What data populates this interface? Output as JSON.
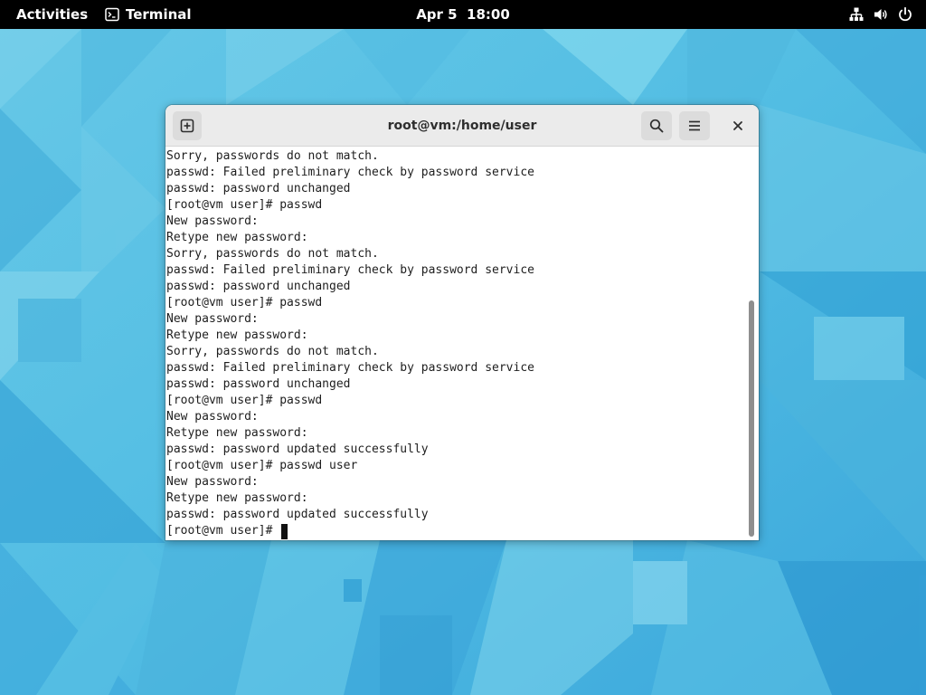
{
  "topbar": {
    "activities_label": "Activities",
    "app_name": "Terminal",
    "clock": "Apr 5  18:00",
    "tray_icons": [
      "network-wired-icon",
      "volume-icon",
      "power-icon"
    ]
  },
  "window": {
    "title": "root@vm:/home/user",
    "icons": [
      "new-tab-icon",
      "search-icon",
      "hamburger-menu-icon",
      "close-icon"
    ]
  },
  "terminal": {
    "lines": [
      "Sorry, passwords do not match.",
      "passwd: Failed preliminary check by password service",
      "passwd: password unchanged",
      "[root@vm user]# passwd",
      "New password:",
      "Retype new password:",
      "Sorry, passwords do not match.",
      "passwd: Failed preliminary check by password service",
      "passwd: password unchanged",
      "[root@vm user]# passwd",
      "New password:",
      "Retype new password:",
      "Sorry, passwords do not match.",
      "passwd: Failed preliminary check by password service",
      "passwd: password unchanged",
      "[root@vm user]# passwd",
      "New password:",
      "Retype new password:",
      "passwd: password updated successfully",
      "[root@vm user]# passwd user",
      "New password:",
      "Retype new password:",
      "passwd: password updated successfully"
    ],
    "prompt": "[root@vm user]# "
  },
  "colors": {
    "topbar_bg": "#000000",
    "headerbar_bg": "#ebebeb",
    "terminal_bg": "#ffffff",
    "terminal_fg": "#1e1e1e",
    "wallpaper_base": "#5cc4e6"
  }
}
